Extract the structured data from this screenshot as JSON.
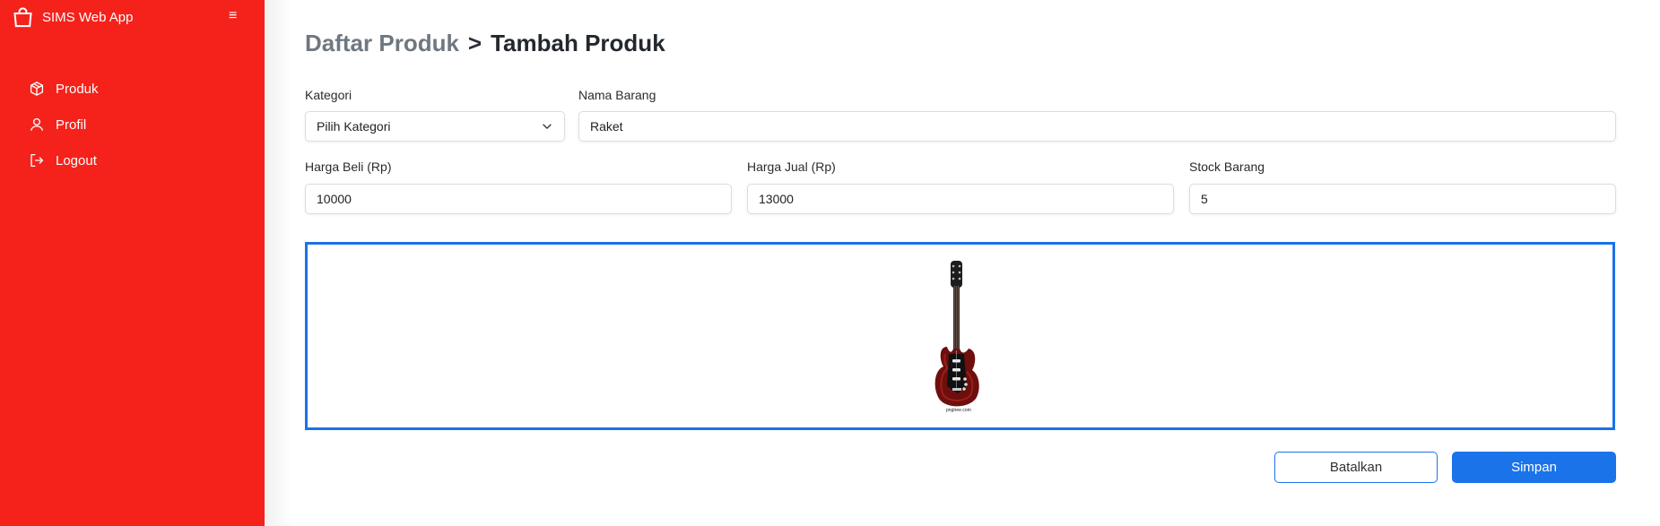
{
  "app": {
    "name": "SIMS Web App",
    "menu_toggle_glyph": "≡",
    "brand_icon": "shopping-bag-icon",
    "accent_color": "#f5221b",
    "primary_color": "#1a73e8"
  },
  "sidebar": {
    "items": [
      {
        "label": "Produk",
        "icon": "box-icon"
      },
      {
        "label": "Profil",
        "icon": "user-icon"
      },
      {
        "label": "Logout",
        "icon": "logout-icon"
      }
    ]
  },
  "breadcrumb": {
    "parent": "Daftar Produk",
    "separator": ">",
    "current": "Tambah Produk"
  },
  "form": {
    "kategori": {
      "label": "Kategori",
      "value": "Pilih Kategori"
    },
    "nama_barang": {
      "label": "Nama Barang",
      "value": "Raket"
    },
    "harga_beli": {
      "label": "Harga Beli (Rp)",
      "value": "10000"
    },
    "harga_jual": {
      "label": "Harga Jual (Rp)",
      "value": "13000"
    },
    "stock_barang": {
      "label": "Stock Barang",
      "value": "5"
    },
    "image": {
      "alt": "electric guitar",
      "caption": "pngtree.com"
    }
  },
  "actions": {
    "cancel_label": "Batalkan",
    "save_label": "Simpan"
  }
}
